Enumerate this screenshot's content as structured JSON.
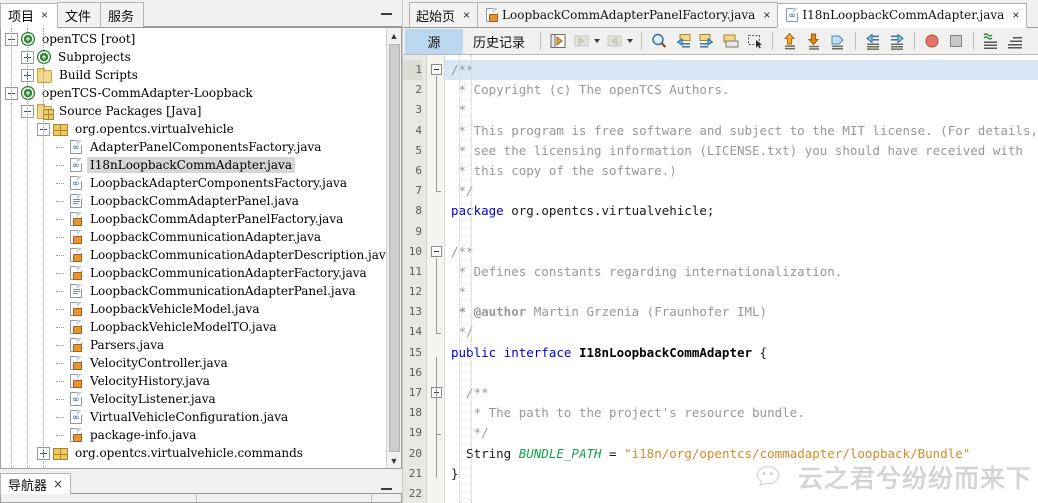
{
  "app": {
    "name": "NetBeans IDE",
    "accent": "#bcd7f0",
    "selection_gray": "#d6d6d6",
    "highlight_line": "#d9e8f7"
  },
  "left_panel": {
    "tabs": [
      {
        "label": "项目",
        "active": true,
        "closable": true
      },
      {
        "label": "文件",
        "active": false,
        "closable": false
      },
      {
        "label": "服务",
        "active": false,
        "closable": false
      }
    ],
    "minimize_label": "—",
    "scroll": {
      "up_arrow": "˄",
      "down_arrow": "˅"
    },
    "tree": [
      {
        "depth": 0,
        "toggle": "minus",
        "icon": "project-icon",
        "label": "openTCS [root]",
        "selected": false
      },
      {
        "depth": 1,
        "toggle": "plus",
        "icon": "project-icon",
        "label": "Subprojects",
        "selected": false
      },
      {
        "depth": 1,
        "toggle": "plus",
        "icon": "folder-icon",
        "label": "Build Scripts",
        "selected": false
      },
      {
        "depth": 0,
        "toggle": "minus",
        "icon": "project-icon",
        "label": "openTCS-CommAdapter-Loopback",
        "selected": false
      },
      {
        "depth": 1,
        "toggle": "minus",
        "icon": "source-packages-icon",
        "label": "Source Packages [Java]",
        "selected": false
      },
      {
        "depth": 2,
        "toggle": "minus",
        "icon": "package-icon",
        "label": "org.opentcs.virtualvehicle",
        "selected": false
      },
      {
        "depth": 3,
        "toggle": "none",
        "icon": "java-interface-icon",
        "label": "AdapterPanelComponentsFactory.java",
        "selected": false
      },
      {
        "depth": 3,
        "toggle": "none",
        "icon": "java-interface-icon",
        "label": "I18nLoopbackCommAdapter.java",
        "selected": true
      },
      {
        "depth": 3,
        "toggle": "none",
        "icon": "java-interface-icon",
        "label": "LoopbackAdapterComponentsFactory.java",
        "selected": false
      },
      {
        "depth": 3,
        "toggle": "none",
        "icon": "java-form-icon",
        "label": "LoopbackCommAdapterPanel.java",
        "selected": false
      },
      {
        "depth": 3,
        "toggle": "none",
        "icon": "java-class-icon",
        "label": "LoopbackCommAdapterPanelFactory.java",
        "selected": false
      },
      {
        "depth": 3,
        "toggle": "none",
        "icon": "java-class-icon",
        "label": "LoopbackCommunicationAdapter.java",
        "selected": false
      },
      {
        "depth": 3,
        "toggle": "none",
        "icon": "java-class-icon",
        "label": "LoopbackCommunicationAdapterDescription.java",
        "selected": false
      },
      {
        "depth": 3,
        "toggle": "none",
        "icon": "java-class-icon",
        "label": "LoopbackCommunicationAdapterFactory.java",
        "selected": false
      },
      {
        "depth": 3,
        "toggle": "none",
        "icon": "java-form-icon",
        "label": "LoopbackCommunicationAdapterPanel.java",
        "selected": false
      },
      {
        "depth": 3,
        "toggle": "none",
        "icon": "java-class-icon",
        "label": "LoopbackVehicleModel.java",
        "selected": false
      },
      {
        "depth": 3,
        "toggle": "none",
        "icon": "java-class-icon",
        "label": "LoopbackVehicleModelTO.java",
        "selected": false
      },
      {
        "depth": 3,
        "toggle": "none",
        "icon": "java-class-icon",
        "label": "Parsers.java",
        "selected": false
      },
      {
        "depth": 3,
        "toggle": "none",
        "icon": "java-class-icon",
        "label": "VelocityController.java",
        "selected": false
      },
      {
        "depth": 3,
        "toggle": "none",
        "icon": "java-class-icon",
        "label": "VelocityHistory.java",
        "selected": false
      },
      {
        "depth": 3,
        "toggle": "none",
        "icon": "java-interface-icon",
        "label": "VelocityListener.java",
        "selected": false
      },
      {
        "depth": 3,
        "toggle": "none",
        "icon": "java-interface-icon",
        "label": "VirtualVehicleConfiguration.java",
        "selected": false
      },
      {
        "depth": 3,
        "toggle": "none",
        "icon": "java-class-icon",
        "label": "package-info.java",
        "selected": false
      },
      {
        "depth": 2,
        "toggle": "plus",
        "icon": "package-icon",
        "label": "org.opentcs.virtualvehicle.commands",
        "selected": false
      }
    ]
  },
  "navigator": {
    "tab_label": "导航器",
    "close_x": "×",
    "minimize_label": "—"
  },
  "editor": {
    "tabs": [
      {
        "label": "起始页",
        "icon": "none",
        "active": false,
        "chinese": true
      },
      {
        "label": "LoopbackCommAdapterPanelFactory.java",
        "icon": "java-class-icon",
        "active": false,
        "chinese": false
      },
      {
        "label": "I18nLoopbackCommAdapter.java",
        "icon": "java-interface-icon",
        "active": true,
        "chinese": false
      }
    ],
    "close_x": "×",
    "toolbar": {
      "view_tabs": [
        {
          "label": "源",
          "selected": true
        },
        {
          "label": "历史记录",
          "selected": false
        }
      ],
      "buttons": [
        {
          "name": "toggle-highlight-icon"
        },
        {
          "name": "last-edit-back-icon",
          "has_dropdown": true,
          "disabled": true
        },
        {
          "name": "last-edit-forward-icon",
          "has_dropdown": true,
          "disabled": true
        },
        {
          "name": "find-selection-icon"
        },
        {
          "name": "previous-bookmark-icon"
        },
        {
          "name": "next-bookmark-icon"
        },
        {
          "name": "toggle-bookmark-icon"
        },
        {
          "name": "toggle-rectangular-selection-icon"
        },
        {
          "name": "previous-error-icon"
        },
        {
          "name": "next-error-icon"
        },
        {
          "name": "shift-line-icon"
        },
        {
          "name": "shift-line-left-icon"
        },
        {
          "name": "shift-line-right-icon"
        },
        {
          "name": "toggle-breakpoint-icon"
        },
        {
          "name": "stop-icon"
        },
        {
          "name": "comment-icon"
        },
        {
          "name": "uncomment-icon"
        }
      ]
    },
    "line_numbers": [
      1,
      2,
      3,
      4,
      5,
      6,
      7,
      8,
      9,
      10,
      11,
      12,
      13,
      14,
      15,
      16,
      17,
      18,
      19,
      20,
      21,
      22
    ],
    "current_line": 1,
    "code_lines": [
      {
        "n": 1,
        "tokens": [
          {
            "t": "comment",
            "v": "/**"
          }
        ]
      },
      {
        "n": 2,
        "tokens": [
          {
            "t": "comment",
            "v": " * Copyright (c) The openTCS Authors."
          }
        ]
      },
      {
        "n": 3,
        "tokens": [
          {
            "t": "comment",
            "v": " *"
          }
        ]
      },
      {
        "n": 4,
        "tokens": [
          {
            "t": "comment",
            "v": " * This program is free software and subject to the MIT license. (For details,"
          }
        ]
      },
      {
        "n": 5,
        "tokens": [
          {
            "t": "comment",
            "v": " * see the licensing information (LICENSE.txt) you should have received with"
          }
        ]
      },
      {
        "n": 6,
        "tokens": [
          {
            "t": "comment",
            "v": " * this copy of the software.)"
          }
        ]
      },
      {
        "n": 7,
        "tokens": [
          {
            "t": "comment",
            "v": " */"
          }
        ]
      },
      {
        "n": 8,
        "tokens": [
          {
            "t": "keyword",
            "v": "package"
          },
          {
            "t": "plain",
            "v": " org.opentcs.virtualvehicle;"
          }
        ]
      },
      {
        "n": 9,
        "tokens": []
      },
      {
        "n": 10,
        "tokens": [
          {
            "t": "comment",
            "v": "/**"
          }
        ]
      },
      {
        "n": 11,
        "tokens": [
          {
            "t": "comment",
            "v": " * Defines constants regarding internationalization."
          }
        ]
      },
      {
        "n": 12,
        "tokens": [
          {
            "t": "comment",
            "v": " *"
          }
        ]
      },
      {
        "n": 13,
        "tokens": [
          {
            "t": "comment-tag",
            "v": " * @author"
          },
          {
            "t": "comment",
            "v": " Martin Grzenia (Fraunhofer IML)"
          }
        ]
      },
      {
        "n": 14,
        "tokens": [
          {
            "t": "comment",
            "v": " */"
          }
        ]
      },
      {
        "n": 15,
        "tokens": [
          {
            "t": "keyword",
            "v": "public interface "
          },
          {
            "t": "class",
            "v": "I18nLoopbackCommAdapter"
          },
          {
            "t": "plain",
            "v": " {"
          }
        ]
      },
      {
        "n": 16,
        "tokens": []
      },
      {
        "n": 17,
        "tokens": [
          {
            "t": "comment",
            "v": "  /**"
          }
        ]
      },
      {
        "n": 18,
        "tokens": [
          {
            "t": "comment",
            "v": "   * The path to the project's resource bundle."
          }
        ]
      },
      {
        "n": 19,
        "tokens": [
          {
            "t": "comment",
            "v": "   */"
          }
        ]
      },
      {
        "n": 20,
        "tokens": [
          {
            "t": "plain",
            "v": "  String "
          },
          {
            "t": "field",
            "v": "BUNDLE_PATH"
          },
          {
            "t": "plain",
            "v": " = "
          },
          {
            "t": "string",
            "v": "\"i18n/org/opentcs/commadapter/loopback/Bundle\""
          }
        ]
      },
      {
        "n": 21,
        "tokens": [
          {
            "t": "plain",
            "v": "}"
          }
        ]
      },
      {
        "n": 22,
        "tokens": []
      }
    ]
  },
  "watermark": {
    "text": "云之君兮纷纷而来下",
    "icon": "wechat-icon"
  },
  "colors": {
    "comment": "#989898",
    "keyword": "#0000c8",
    "class": "#000000",
    "field": "#17a34a",
    "string": "#d48a28",
    "plain": "#1a1a1a"
  }
}
